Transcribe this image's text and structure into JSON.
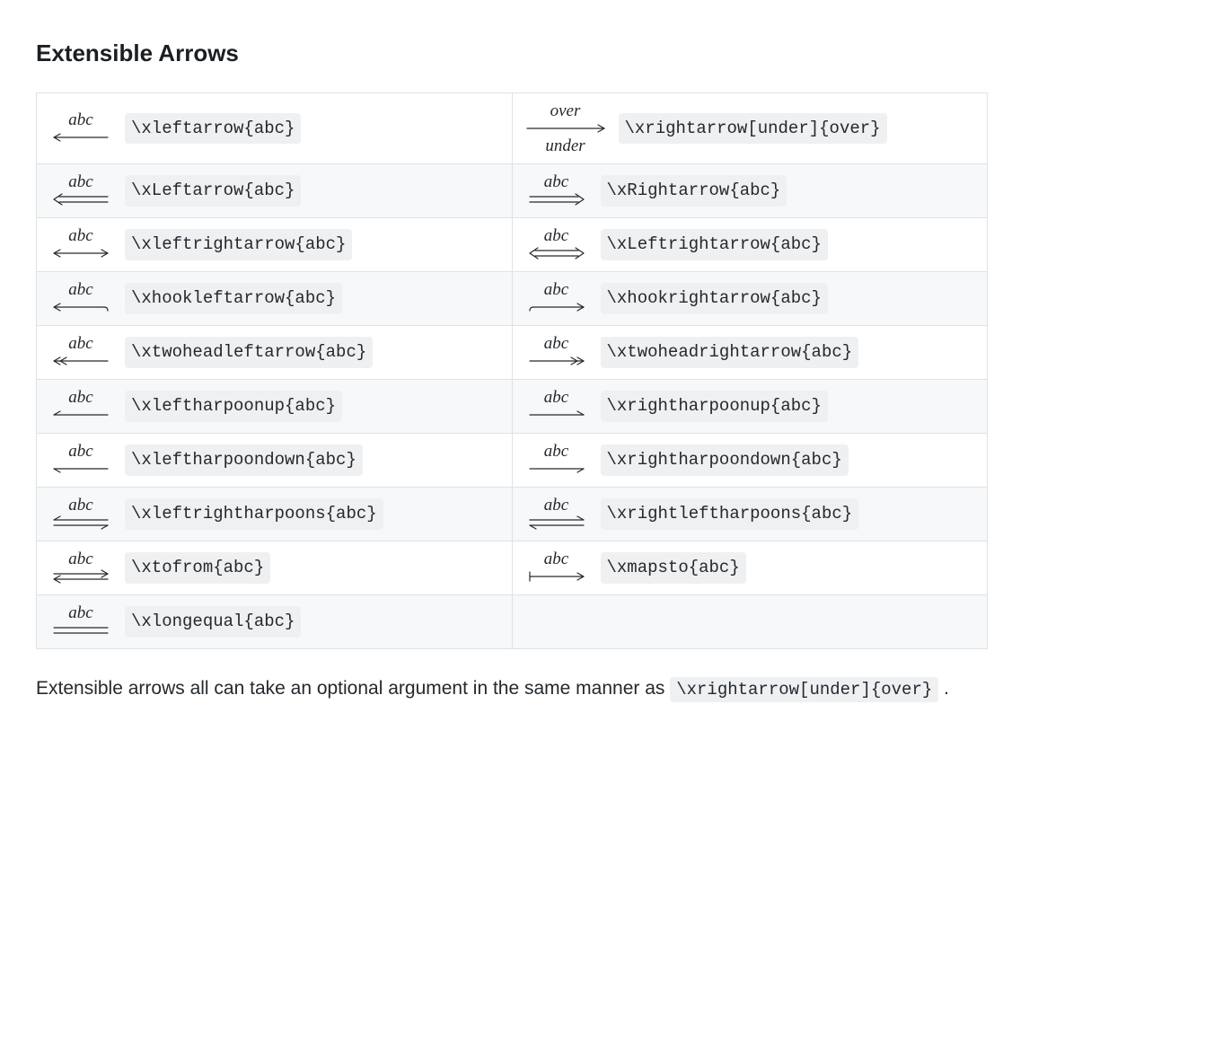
{
  "section_title": "Extensible Arrows",
  "note_prefix": "Extensible arrows all can take an optional argument in the same manner as ",
  "note_code": "\\xrightarrow[under]{over}",
  "note_suffix": " .",
  "rows": [
    {
      "left": {
        "over": "abc",
        "under": "",
        "tex": "\\xleftarrow{abc}",
        "shape": "leftarrow"
      },
      "right": {
        "over": "over",
        "under": "under",
        "tex": "\\xrightarrow[under]{over}",
        "shape": "rightarrow"
      }
    },
    {
      "left": {
        "over": "abc",
        "under": "",
        "tex": "\\xLeftarrow{abc}",
        "shape": "Leftarrow"
      },
      "right": {
        "over": "abc",
        "under": "",
        "tex": "\\xRightarrow{abc}",
        "shape": "Rightarrow"
      }
    },
    {
      "left": {
        "over": "abc",
        "under": "",
        "tex": "\\xleftrightarrow{abc}",
        "shape": "leftrightarrow"
      },
      "right": {
        "over": "abc",
        "under": "",
        "tex": "\\xLeftrightarrow{abc}",
        "shape": "Leftrightarrow"
      }
    },
    {
      "left": {
        "over": "abc",
        "under": "",
        "tex": "\\xhookleftarrow{abc}",
        "shape": "hookleftarrow"
      },
      "right": {
        "over": "abc",
        "under": "",
        "tex": "\\xhookrightarrow{abc}",
        "shape": "hookrightarrow"
      }
    },
    {
      "left": {
        "over": "abc",
        "under": "",
        "tex": "\\xtwoheadleftarrow{abc}",
        "shape": "twoheadleftarrow"
      },
      "right": {
        "over": "abc",
        "under": "",
        "tex": "\\xtwoheadrightarrow{abc}",
        "shape": "twoheadrightarrow"
      }
    },
    {
      "left": {
        "over": "abc",
        "under": "",
        "tex": "\\xleftharpoonup{abc}",
        "shape": "leftharpoonup"
      },
      "right": {
        "over": "abc",
        "under": "",
        "tex": "\\xrightharpoonup{abc}",
        "shape": "rightharpoonup"
      }
    },
    {
      "left": {
        "over": "abc",
        "under": "",
        "tex": "\\xleftharpoondown{abc}",
        "shape": "leftharpoondown"
      },
      "right": {
        "over": "abc",
        "under": "",
        "tex": "\\xrightharpoondown{abc}",
        "shape": "rightharpoondown"
      }
    },
    {
      "left": {
        "over": "abc",
        "under": "",
        "tex": "\\xleftrightharpoons{abc}",
        "shape": "leftrightharpoons"
      },
      "right": {
        "over": "abc",
        "under": "",
        "tex": "\\xrightleftharpoons{abc}",
        "shape": "rightleftharpoons"
      }
    },
    {
      "left": {
        "over": "abc",
        "under": "",
        "tex": "\\xtofrom{abc}",
        "shape": "tofrom"
      },
      "right": {
        "over": "abc",
        "under": "",
        "tex": "\\xmapsto{abc}",
        "shape": "mapsto"
      }
    },
    {
      "left": {
        "over": "abc",
        "under": "",
        "tex": "\\xlongequal{abc}",
        "shape": "longequal"
      },
      "right": null
    }
  ]
}
